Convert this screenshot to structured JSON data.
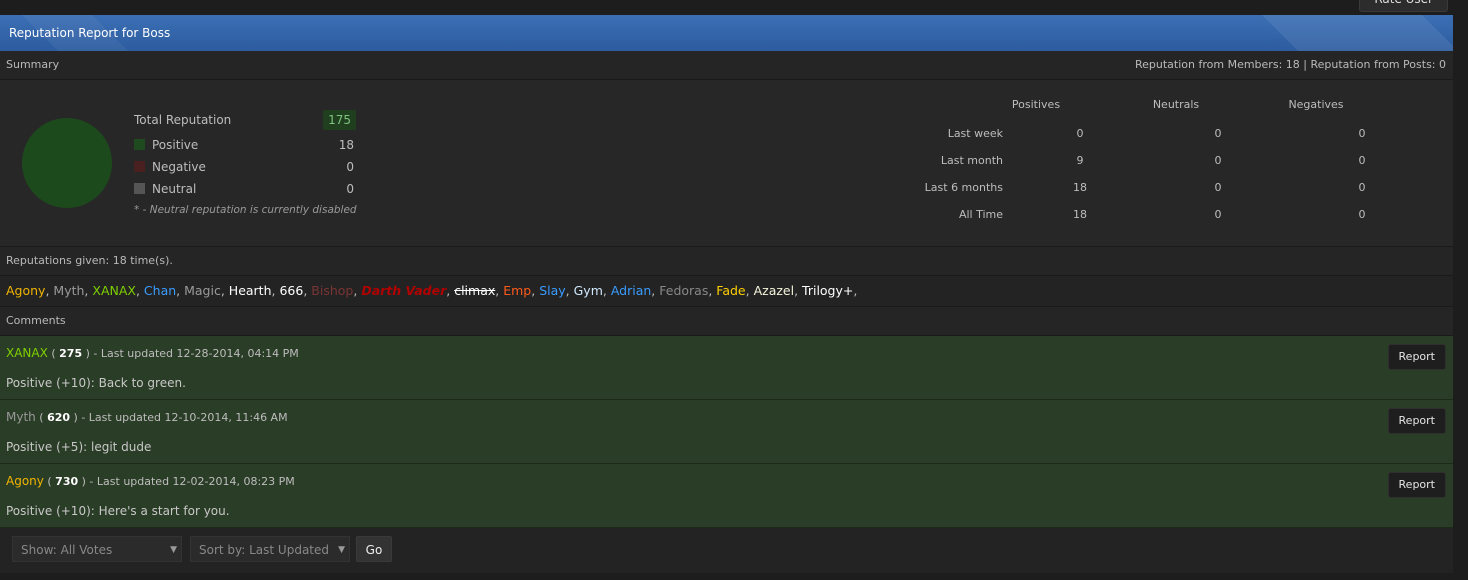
{
  "top_button_label": "Rate User",
  "header": {
    "title": "Reputation Report for Boss"
  },
  "summary_bar": {
    "label": "Summary",
    "right_text": "Reputation from Members: 18 | Reputation from Posts: 0"
  },
  "legend": {
    "total_label": "Total Reputation",
    "total_value": "175",
    "items": [
      {
        "label": "Positive",
        "value": "18",
        "color": "#1f4a1f"
      },
      {
        "label": "Negative",
        "value": "0",
        "color": "#4a1f1f"
      },
      {
        "label": "Neutral",
        "value": "0",
        "color": "#555555"
      }
    ],
    "note": "* - Neutral reputation is currently disabled"
  },
  "stats": {
    "headers": [
      "Positives",
      "Neutrals",
      "Negatives"
    ],
    "rows": [
      {
        "label": "Last week",
        "values": [
          "0",
          "0",
          "0"
        ]
      },
      {
        "label": "Last month",
        "values": [
          "9",
          "0",
          "0"
        ]
      },
      {
        "label": "Last 6 months",
        "values": [
          "18",
          "0",
          "0"
        ]
      },
      {
        "label": "All Time",
        "values": [
          "18",
          "0",
          "0"
        ]
      }
    ]
  },
  "given_bar": {
    "label": "Reputations given: 18 time(s)."
  },
  "givers": [
    {
      "name": "Agony",
      "color": "#f0b400"
    },
    {
      "name": "Myth",
      "color": "#999999"
    },
    {
      "name": "XANAX",
      "color": "#7fd000"
    },
    {
      "name": "Chan",
      "color": "#3a9cff"
    },
    {
      "name": "Magic",
      "color": "#9a9a9a"
    },
    {
      "name": "Hearth",
      "color": "#ffffff"
    },
    {
      "name": "666",
      "color": "#ffffff"
    },
    {
      "name": "Bishop",
      "color": "#7a3434"
    },
    {
      "name": "Darth Vader",
      "color": "#b00000"
    },
    {
      "name": "climax",
      "color": "#ffffff"
    },
    {
      "name": "Emp",
      "color": "#ff5a1a"
    },
    {
      "name": "Slay",
      "color": "#3a9cff"
    },
    {
      "name": "Gym",
      "color": "#cfe8ff"
    },
    {
      "name": "Adrian",
      "color": "#3a9cff"
    },
    {
      "name": "Fedoras",
      "color": "#888888"
    },
    {
      "name": "Fade",
      "color": "#ffd000"
    },
    {
      "name": "Azazel",
      "color": "#f5f5dc"
    },
    {
      "name": "Trilogy+",
      "color": "#ffffff"
    }
  ],
  "comments_bar": {
    "label": "Comments"
  },
  "comments": [
    {
      "user": "XANAX",
      "user_color": "#7fd000",
      "rep": "275",
      "updated": "Last updated 12-28-2014, 04:14 PM",
      "text": "Positive (+10): Back to green.",
      "report": "Report"
    },
    {
      "user": "Myth",
      "user_color": "#999999",
      "rep": "620",
      "updated": "Last updated 12-10-2014, 11:46 AM",
      "text": "Positive (+5): legit dude",
      "report": "Report"
    },
    {
      "user": "Agony",
      "user_color": "#f0b400",
      "rep": "730",
      "updated": "Last updated 12-02-2014, 08:23 PM",
      "text": "Positive (+10): Here's a start for you.",
      "report": "Report"
    }
  ],
  "controls": {
    "show": "Show: All Votes",
    "sort": "Sort by: Last Updated",
    "go": "Go"
  }
}
